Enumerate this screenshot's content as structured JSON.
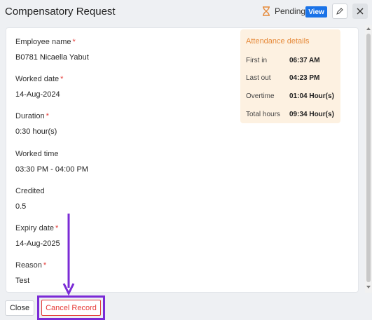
{
  "header": {
    "title": "Compensatory Request",
    "status": "Pending",
    "view_label": "View"
  },
  "fields": [
    {
      "label": "Employee name",
      "required": "*",
      "value": "B0781 Nicaella Yabut"
    },
    {
      "label": "Worked date",
      "required": "*",
      "value": "14-Aug-2024"
    },
    {
      "label": "Duration",
      "required": "*",
      "value": "0:30 hour(s)"
    },
    {
      "label": "Worked time",
      "required": "",
      "value": "03:30 PM - 04:00 PM"
    },
    {
      "label": "Credited",
      "required": "",
      "value": "0.5"
    },
    {
      "label": "Expiry date",
      "required": "*",
      "value": "14-Aug-2025"
    },
    {
      "label": "Reason",
      "required": "*",
      "value": "Test"
    }
  ],
  "attendance": {
    "title": "Attendance details",
    "rows": [
      {
        "label": "First in",
        "value": "06:37 AM"
      },
      {
        "label": "Last out",
        "value": "04:23 PM"
      },
      {
        "label": "Overtime",
        "value": "01:04 Hour(s)"
      },
      {
        "label": "Total hours",
        "value": "09:34 Hour(s)"
      }
    ]
  },
  "footer": {
    "close_label": "Close",
    "cancel_label": "Cancel Record"
  },
  "colors": {
    "accent": "#1a73e8",
    "required": "#e53935",
    "attendance_bg": "#fdf1e1",
    "attendance_title": "#e68a3a",
    "annotation": "#7b2bd6"
  },
  "icons": {
    "status": "hourglass-icon",
    "edit": "pencil-icon",
    "close": "close-icon"
  }
}
